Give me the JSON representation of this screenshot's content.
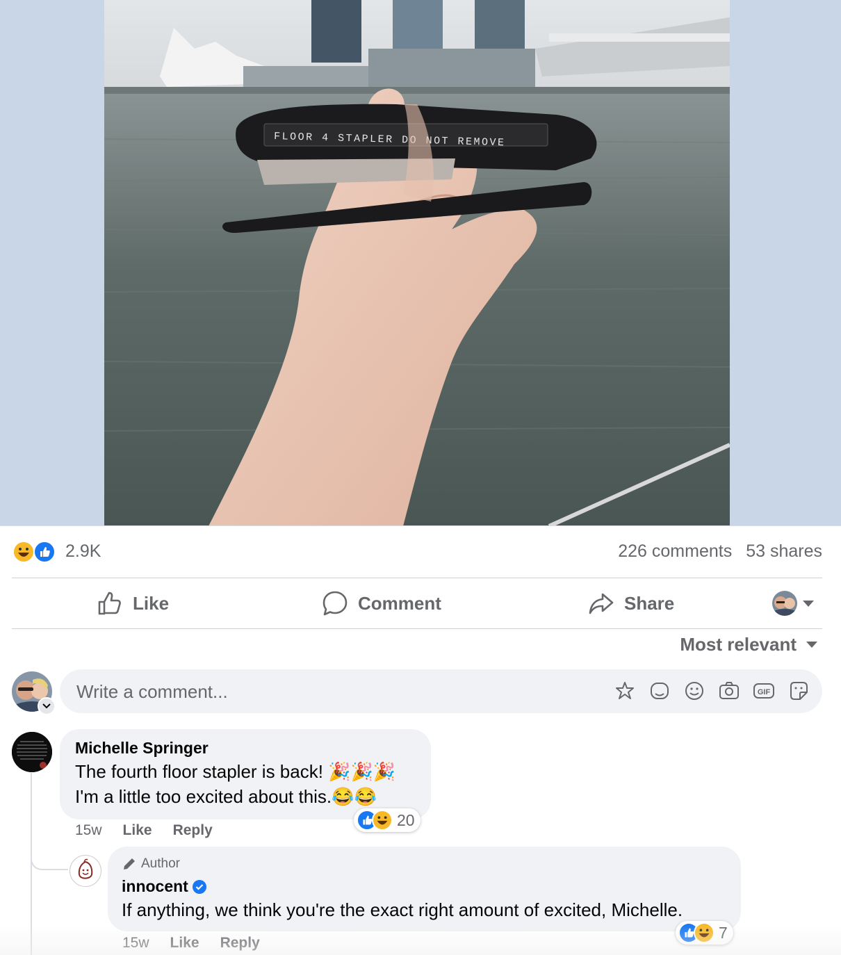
{
  "post": {
    "photo_alt": "Hand holding a black stapler labelled FLOOR 4 STAPLER DO NOT REMOVE in front of a bay",
    "stapler_label": "FLOOR 4 STAPLER DO NOT REMOVE"
  },
  "stats": {
    "reactions_count": "2.9K",
    "comments": "226 comments",
    "shares": "53 shares"
  },
  "actions": {
    "like": "Like",
    "comment": "Comment",
    "share": "Share"
  },
  "sort": {
    "label": "Most relevant"
  },
  "composer": {
    "placeholder": "Write a comment..."
  },
  "comments": [
    {
      "author": "Michelle Springer",
      "line1": "The fourth floor stapler is back! 🎉🎉🎉",
      "line2": "I'm a little too excited about this.😂😂",
      "time": "15w",
      "like": "Like",
      "reply": "Reply",
      "reactions": "20"
    },
    {
      "badge": "Author",
      "author": "innocent",
      "text": "If anything, we think you're the exact right amount of excited, Michelle.",
      "time": "15w",
      "like": "Like",
      "reply": "Reply",
      "reactions": "7"
    }
  ],
  "colors": {
    "accent": "#1877f2",
    "muted": "#65676b",
    "bubble": "#f0f2f5",
    "haha": "#f7b928"
  }
}
